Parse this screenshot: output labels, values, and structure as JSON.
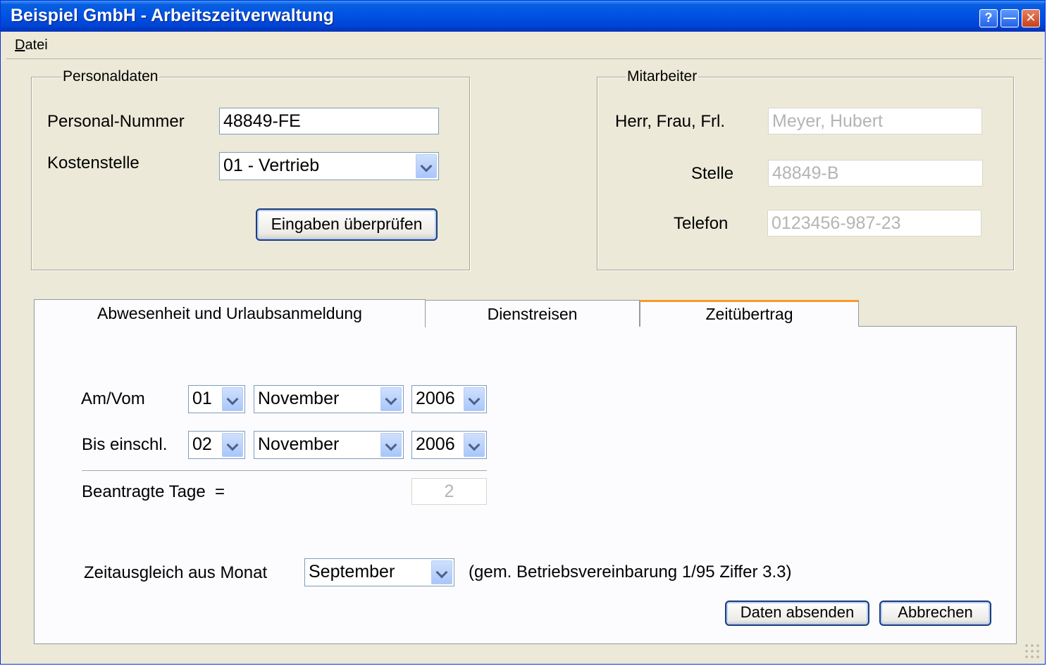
{
  "window": {
    "title": "Beispiel GmbH - Arbeitszeitverwaltung",
    "help_glyph": "?",
    "min_glyph": "—",
    "close_glyph": "✕"
  },
  "menu": {
    "items": [
      "Datei"
    ]
  },
  "personal": {
    "title": "Personaldaten",
    "nummer_label": "Personal-Nummer",
    "nummer_value": "48849-FE",
    "kostenstelle_label": "Kostenstelle",
    "kostenstelle_value": "01 - Vertrieb",
    "check_button": "Eingaben überprüfen"
  },
  "mitarbeiter": {
    "title": "Mitarbeiter",
    "anrede_label": "Herr, Frau, Frl.",
    "anrede_value": "Meyer, Hubert",
    "stelle_label": "Stelle",
    "stelle_value": "48849-B",
    "telefon_label": "Telefon",
    "telefon_value": "0123456-987-23"
  },
  "tabs": [
    {
      "label": "Abwesenheit und Urlaubsanmeldung",
      "active": true
    },
    {
      "label": "Dienstreisen",
      "active": false
    },
    {
      "label": "Zeitübertrag",
      "active": false,
      "hover": true
    }
  ],
  "absence": {
    "from_label": "Am/Vom",
    "from_day": "01",
    "from_month": "November",
    "from_year": "2006",
    "to_label": "Bis einschl.",
    "to_day": "02",
    "to_month": "November",
    "to_year": "2006",
    "days_label": "Beantragte Tage  =",
    "days_value": "2",
    "month_label": "Zeitausgleich aus Monat",
    "month_value": "September",
    "note": "(gem. Betriebsvereinbarung 1/95 Ziffer 3.3)",
    "submit_button": "Daten absenden",
    "cancel_button": "Abbrechen"
  },
  "colors": {
    "titlebar": "#0055e5",
    "window_bg": "#ece9d8",
    "tab_hover": "#f79a29",
    "focus": "#1a3d7a"
  }
}
